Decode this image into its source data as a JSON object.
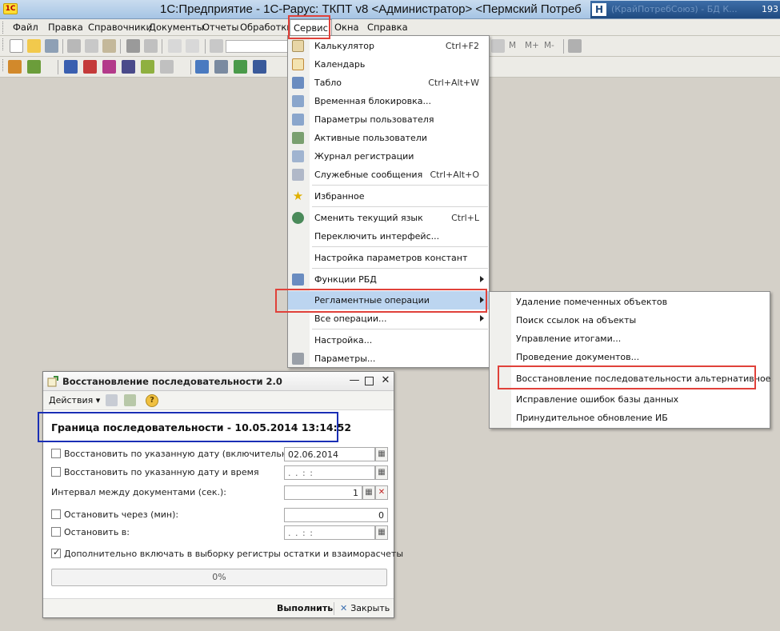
{
  "window": {
    "title": "1С:Предприятие - 1С-Рарус: ТКПТ v8 <Администратор> <Пермский Потреб",
    "overlay_ghost": "(КрайПотребСоюз) - БД К...",
    "overlay_number": "193"
  },
  "menubar": {
    "items": [
      "Файл",
      "Правка",
      "Справочники",
      "Документы",
      "Отчеты",
      "Обработки",
      "Сервис",
      "Окна",
      "Справка"
    ]
  },
  "toolbar": {
    "zoom_labels": [
      "M",
      "M+",
      "M-"
    ]
  },
  "service_menu": {
    "items": [
      {
        "label": "Калькулятор",
        "shortcut": "Ctrl+F2",
        "icon": "calculator-icon"
      },
      {
        "label": "Календарь",
        "shortcut": "",
        "icon": "calendar-icon"
      },
      {
        "label": "Табло",
        "shortcut": "Ctrl+Alt+W",
        "icon": "board-icon"
      },
      {
        "label": "Временная блокировка...",
        "shortcut": "",
        "icon": "lock-user-icon"
      },
      {
        "label": "Параметры пользователя",
        "shortcut": "",
        "icon": "user-settings-icon"
      },
      {
        "label": "Активные пользователи",
        "shortcut": "",
        "icon": "active-users-icon"
      },
      {
        "label": "Журнал регистрации",
        "shortcut": "",
        "icon": "log-icon"
      },
      {
        "label": "Служебные сообщения",
        "shortcut": "Ctrl+Alt+O",
        "icon": "messages-icon"
      },
      {
        "label": "Избранное",
        "shortcut": "",
        "icon": "star-icon"
      },
      {
        "label": "Сменить текущий язык",
        "shortcut": "Ctrl+L",
        "icon": "language-icon"
      },
      {
        "label": "Переключить интерфейс...",
        "shortcut": "",
        "icon": ""
      },
      {
        "label": "Настройка параметров констант",
        "shortcut": "",
        "icon": ""
      },
      {
        "label": "Функции РБД",
        "shortcut": "",
        "icon": "rbd-icon"
      },
      {
        "label": "Регламентные операции",
        "shortcut": "",
        "icon": ""
      },
      {
        "label": "Все операции...",
        "shortcut": "",
        "icon": ""
      },
      {
        "label": "Настройка...",
        "shortcut": "",
        "icon": ""
      },
      {
        "label": "Параметры...",
        "shortcut": "",
        "icon": "wrench-icon"
      }
    ]
  },
  "submenu": {
    "items": [
      "Удаление помеченных объектов",
      "Поиск ссылок на объекты",
      "Управление итогами...",
      "Проведение документов...",
      "Восстановление последовательности альтернативное",
      "Исправление ошибок базы данных",
      "Принудительное обновление ИБ"
    ]
  },
  "dialog": {
    "title": "Восстановление последовательности 2.0",
    "actions_label": "Действия",
    "boundary": "Граница последовательности - 10.05.2014 13:14:52",
    "rows": {
      "restore_date": {
        "label": "Восстановить по указанную дату (включительно)",
        "value": "02.06.2014",
        "checked": false
      },
      "restore_datetime": {
        "label": "Восстановить по указанную дату и время",
        "value": " .  .     :  :",
        "checked": false
      },
      "interval": {
        "label": "Интервал между документами (сек.):",
        "value": "1"
      },
      "stop_after": {
        "label": "Остановить через (мин):",
        "value": "0",
        "checked": false
      },
      "stop_at": {
        "label": "Остановить  в:",
        "value": " .  .     :  :",
        "checked": false
      },
      "include_registers": {
        "label": "Дополнительно включать в выборку регистры остатки и взаиморасчеты",
        "checked": true
      }
    },
    "progress": "0%",
    "run_button": "Выполнить",
    "close_button": "Закрыть"
  },
  "colors": {
    "highlight_red": "#e0413a",
    "highlight_blue": "#1a2fb5",
    "menu_selection": "#bcd5f0"
  }
}
